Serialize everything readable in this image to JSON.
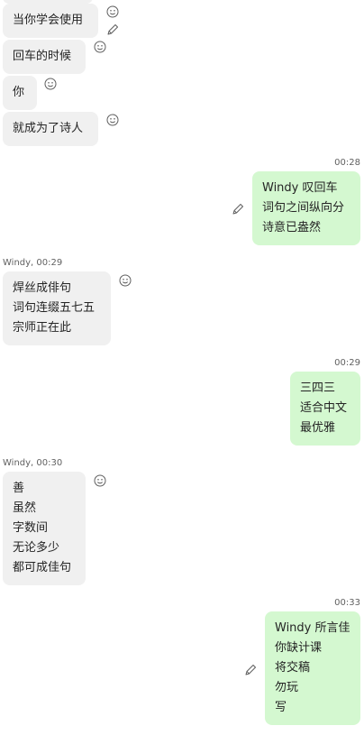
{
  "messages": [
    {
      "lines": [
        "当你学会使用"
      ]
    },
    {
      "lines": [
        "回车的时候"
      ]
    },
    {
      "lines": [
        "你"
      ]
    },
    {
      "lines": [
        "就成为了诗人"
      ]
    },
    {
      "meta": "00:28",
      "lines": [
        "Windy 叹回车",
        "词句之间纵向分",
        "诗意已盎然"
      ]
    },
    {
      "meta": "Windy, 00:29",
      "lines": [
        "焊丝成俳句",
        "词句连缀五七五",
        "宗师正在此"
      ]
    },
    {
      "meta": "00:29",
      "lines": [
        "三四三",
        "适合中文",
        "最优雅"
      ]
    },
    {
      "meta": "Windy, 00:30",
      "lines": [
        "善",
        "虽然",
        "字数间",
        "无论多少",
        "都可成佳句"
      ]
    },
    {
      "meta": "00:33",
      "lines": [
        "Windy 所言佳",
        "你缺计课",
        "将交稿",
        "勿玩",
        "写"
      ]
    }
  ],
  "icons": {
    "reaction": "smiley-reaction-icon",
    "edit": "pencil-edit-icon"
  }
}
